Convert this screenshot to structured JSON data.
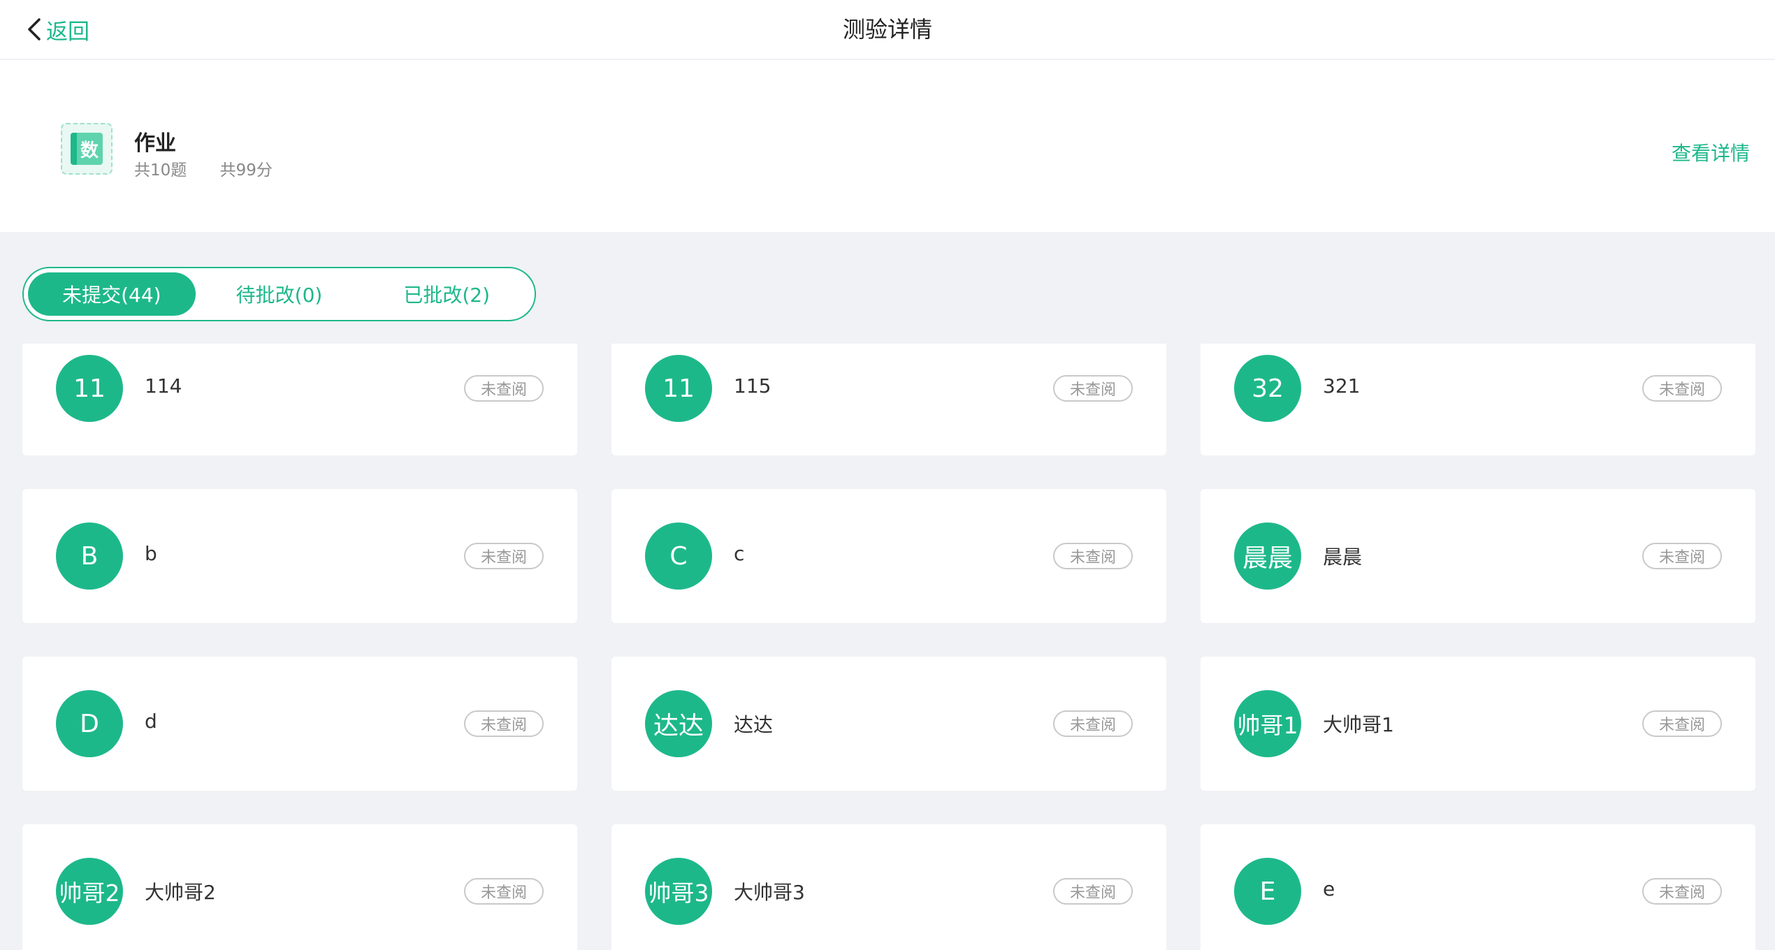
{
  "nav": {
    "back_label": "返回",
    "title": "测验详情"
  },
  "homework": {
    "subject_glyph": "数",
    "title": "作业",
    "question_count": "共10题",
    "total_score": "共99分",
    "detail_link": "查看详情"
  },
  "tabs": [
    {
      "label": "未提交(44)",
      "active": true
    },
    {
      "label": "待批改(0)",
      "active": false
    },
    {
      "label": "已批改(2)",
      "active": false
    }
  ],
  "students": [
    {
      "avatar": "11",
      "name": "114",
      "status": "未查阅"
    },
    {
      "avatar": "11",
      "name": "115",
      "status": "未查阅"
    },
    {
      "avatar": "32",
      "name": "321",
      "status": "未查阅"
    },
    {
      "avatar": "B",
      "name": "b",
      "status": "未查阅"
    },
    {
      "avatar": "C",
      "name": "c",
      "status": "未查阅"
    },
    {
      "avatar": "晨晨",
      "name": "晨晨",
      "status": "未查阅"
    },
    {
      "avatar": "D",
      "name": "d",
      "status": "未查阅"
    },
    {
      "avatar": "达达",
      "name": "达达",
      "status": "未查阅"
    },
    {
      "avatar": "帅哥1",
      "name": "大帅哥1",
      "status": "未查阅"
    },
    {
      "avatar": "帅哥2",
      "name": "大帅哥2",
      "status": "未查阅"
    },
    {
      "avatar": "帅哥3",
      "name": "大帅哥3",
      "status": "未查阅"
    },
    {
      "avatar": "E",
      "name": "e",
      "status": "未查阅"
    }
  ],
  "colors": {
    "accent": "#1db88a",
    "background": "#f0f2f5"
  }
}
